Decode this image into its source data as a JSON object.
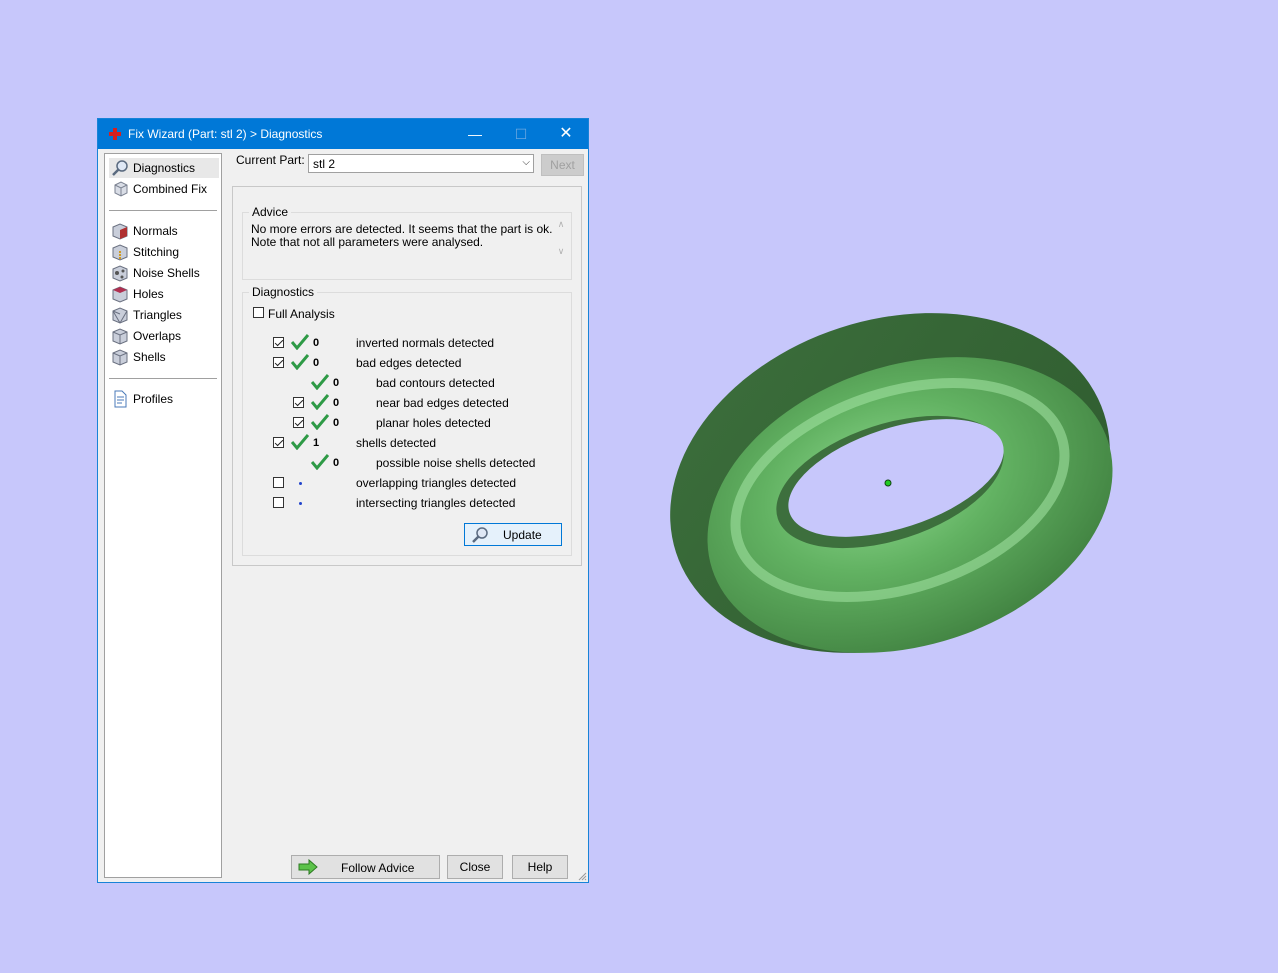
{
  "window": {
    "title": "Fix Wizard (Part: stl 2) > Diagnostics",
    "controls": {
      "minimize": "—",
      "maximize": "☐",
      "close": "✕"
    }
  },
  "nav": {
    "items": [
      {
        "label": "Diagnostics",
        "icon": "magnifier-icon",
        "selected": true
      },
      {
        "label": "Combined Fix",
        "icon": "cube-stack-icon"
      },
      {
        "label": "Normals",
        "icon": "normals-cube-icon"
      },
      {
        "label": "Stitching",
        "icon": "stitching-cube-icon"
      },
      {
        "label": "Noise Shells",
        "icon": "noise-shells-icon"
      },
      {
        "label": "Holes",
        "icon": "holes-cube-icon"
      },
      {
        "label": "Triangles",
        "icon": "triangles-cube-icon"
      },
      {
        "label": "Overlaps",
        "icon": "overlaps-cube-icon"
      },
      {
        "label": "Shells",
        "icon": "shells-cube-icon"
      },
      {
        "label": "Profiles",
        "icon": "profile-document-icon"
      }
    ]
  },
  "header": {
    "current_part_label": "Current Part:",
    "current_part_value": "stl 2",
    "next_label": "Next"
  },
  "advice": {
    "title": "Advice",
    "line1": "No more errors are detected. It seems that the part is ok.",
    "line2": "Note that not all parameters were analysed."
  },
  "diagnostics": {
    "title": "Diagnostics",
    "full_analysis_label": "Full Analysis",
    "rows": [
      {
        "value": "0",
        "label": "inverted normals detected"
      },
      {
        "value": "0",
        "label": "bad edges detected"
      },
      {
        "value": "0",
        "label": "bad contours detected"
      },
      {
        "value": "0",
        "label": "near bad edges detected"
      },
      {
        "value": "0",
        "label": "planar holes detected"
      },
      {
        "value": "1",
        "label": "shells detected"
      },
      {
        "value": "0",
        "label": "possible noise shells detected"
      },
      {
        "value": "",
        "label": "overlapping triangles detected"
      },
      {
        "value": "",
        "label": "intersecting triangles detected"
      }
    ],
    "update_label": "Update"
  },
  "footer": {
    "follow_advice_label": "Follow Advice",
    "close_label": "Close",
    "help_label": "Help"
  },
  "colors": {
    "background": "#c7c7fb",
    "titlebar": "#0078d7",
    "torus_green": "#5fae5f",
    "tick_green": "#2e9a46"
  }
}
